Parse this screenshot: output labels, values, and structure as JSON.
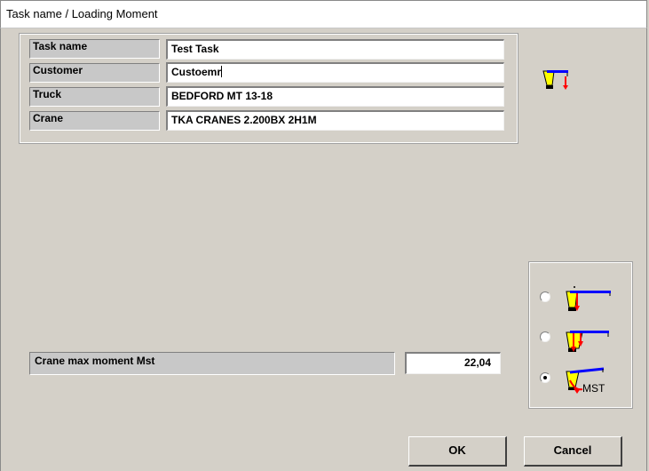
{
  "window": {
    "title": "Task name  /  Loading Moment"
  },
  "task_info": {
    "rows": [
      {
        "label": "Task name",
        "value": "Test Task"
      },
      {
        "label": "Customer",
        "value": "Custoemr"
      },
      {
        "label": "Truck",
        "value": "BEDFORD MT 13-18"
      },
      {
        "label": "Crane",
        "value": "TKA CRANES  2.200BX 2H1M"
      }
    ]
  },
  "moment": {
    "label": "Crane max moment Mst",
    "value": "22,04"
  },
  "mode_options": {
    "selected_index": 2,
    "items": [
      {
        "icon": "crane-boom-load-icon"
      },
      {
        "icon": "crane-boom-double-load-icon"
      },
      {
        "icon": "crane-moment-mst-icon",
        "text": "MST"
      }
    ]
  },
  "buttons": {
    "ok": "OK",
    "cancel": "Cancel"
  },
  "colors": {
    "crane_yellow": "#ffff00",
    "boom_blue": "#0000ff",
    "load_red": "#ff0000"
  }
}
